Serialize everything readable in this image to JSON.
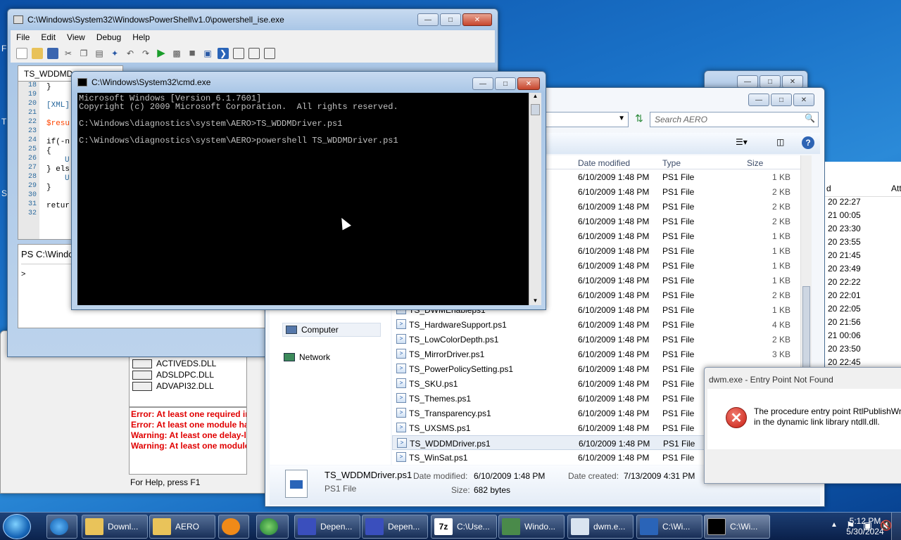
{
  "ise": {
    "title": "C:\\Windows\\System32\\WindowsPowerShell\\v1.0\\powershell_ise.exe",
    "menu": [
      "File",
      "Edit",
      "View",
      "Debug",
      "Help"
    ],
    "tab": "TS_WDDMDriver.ps1",
    "tab_visible": "TS_WDDMD",
    "lines": [
      "18",
      "19",
      "20",
      "21",
      "22",
      "23",
      "24",
      "25",
      "26",
      "27",
      "28",
      "29",
      "30",
      "31",
      "32"
    ],
    "code": [
      "}",
      "[XML]",
      "$resu",
      "if(-n",
      "{",
      "U",
      "} els",
      "U",
      "}",
      "retur"
    ],
    "console_line1": "PS C:\\Windo",
    "console_prompt": ">"
  },
  "cmd": {
    "title": "C:\\Windows\\System32\\cmd.exe",
    "line1": "Microsoft Windows [Version 6.1.7601]",
    "line2": "Copyright (c) 2009 Microsoft Corporation.  All rights reserved.",
    "line3": "C:\\Windows\\diagnostics\\system\\AERO>TS_WDDMDriver.ps1",
    "line4": "C:\\Windows\\diagnostics\\system\\AERO>powershell TS_WDDMDriver.ps1"
  },
  "depwalk": {
    "modules": [
      "ACTIVEDS.DLL",
      "ADSLDPC.DLL",
      "ADVAPI32.DLL"
    ],
    "errors": [
      "Error: At least one required im",
      "Error: At least one module has",
      "Warning: At least one delay-lo",
      "Warning: At least one module"
    ],
    "status": "For Help, press F1"
  },
  "explorer": {
    "search_placeholder": "Search AERO",
    "columns": {
      "date": "Date modified",
      "type": "Type",
      "size": "Size"
    },
    "nav": {
      "computer": "Computer",
      "network": "Network"
    },
    "files": [
      {
        "name": "",
        "date": "6/10/2009 1:48 PM",
        "type": "PS1 File",
        "size": "1 KB"
      },
      {
        "name": "",
        "date": "6/10/2009 1:48 PM",
        "type": "PS1 File",
        "size": "2 KB"
      },
      {
        "name": "",
        "date": "6/10/2009 1:48 PM",
        "type": "PS1 File",
        "size": "2 KB"
      },
      {
        "name": "",
        "date": "6/10/2009 1:48 PM",
        "type": "PS1 File",
        "size": "2 KB"
      },
      {
        "name": "",
        "date": "6/10/2009 1:48 PM",
        "type": "PS1 File",
        "size": "1 KB"
      },
      {
        "name": "",
        "date": "6/10/2009 1:48 PM",
        "type": "PS1 File",
        "size": "1 KB"
      },
      {
        "name": "",
        "date": "6/10/2009 1:48 PM",
        "type": "PS1 File",
        "size": "1 KB"
      },
      {
        "name": "",
        "date": "6/10/2009 1:48 PM",
        "type": "PS1 File",
        "size": "1 KB"
      },
      {
        "name": "",
        "date": "6/10/2009 1:48 PM",
        "type": "PS1 File",
        "size": "2 KB"
      },
      {
        "name": "TS_DWMEnableps1",
        "date": "6/10/2009 1:48 PM",
        "type": "PS1 File",
        "size": "1 KB"
      },
      {
        "name": "TS_HardwareSupport.ps1",
        "date": "6/10/2009 1:48 PM",
        "type": "PS1 File",
        "size": "4 KB"
      },
      {
        "name": "TS_LowColorDepth.ps1",
        "date": "6/10/2009 1:48 PM",
        "type": "PS1 File",
        "size": "2 KB"
      },
      {
        "name": "TS_MirrorDriver.ps1",
        "date": "6/10/2009 1:48 PM",
        "type": "PS1 File",
        "size": "3 KB"
      },
      {
        "name": "TS_PowerPolicySetting.ps1",
        "date": "6/10/2009 1:48 PM",
        "type": "PS1 File",
        "size": ""
      },
      {
        "name": "TS_SKU.ps1",
        "date": "6/10/2009 1:48 PM",
        "type": "PS1 File",
        "size": ""
      },
      {
        "name": "TS_Themes.ps1",
        "date": "6/10/2009 1:48 PM",
        "type": "PS1 File",
        "size": ""
      },
      {
        "name": "TS_Transparency.ps1",
        "date": "6/10/2009 1:48 PM",
        "type": "PS1 File",
        "size": ""
      },
      {
        "name": "TS_UXSMS.ps1",
        "date": "6/10/2009 1:48 PM",
        "type": "PS1 File",
        "size": ""
      },
      {
        "name": "TS_WDDMDriver.ps1",
        "date": "6/10/2009 1:48 PM",
        "type": "PS1 File",
        "size": ""
      },
      {
        "name": "TS_WinSat.ps1",
        "date": "6/10/2009 1:48 PM",
        "type": "PS1 File",
        "size": ""
      }
    ],
    "details": {
      "name": "TS_WDDMDriver.ps1",
      "kind": "PS1 File",
      "mod_label": "Date modified:",
      "mod": "6/10/2009 1:48 PM",
      "size_label": "Size:",
      "size": "682 bytes",
      "created_label": "Date created:",
      "created": "7/13/2009 4:31 PM"
    }
  },
  "datelist": {
    "header_d": "d",
    "header_att": "Att",
    "dates": [
      "20 22:27",
      "21 00:05",
      "20 23:30",
      "20 23:55",
      "20 21:45",
      "20 23:49",
      "20 22:22",
      "20 22:01",
      "20 22:05",
      "20 21:56",
      "21 00:06",
      "20 23:50",
      "20 22:45"
    ]
  },
  "dialog": {
    "title": "dwm.exe - Entry Point Not Found",
    "line1": "The procedure entry point RtlPublishWr",
    "line2": "in the dynamic link library ntdll.dll."
  },
  "taskbar": {
    "items": [
      "Downl...",
      "AERO",
      "",
      "",
      "Depen...",
      "Depen...",
      "C:\\Use...",
      "Windo...",
      "dwm.e...",
      "C:\\Wi...",
      "C:\\Wi..."
    ],
    "time": "5:12 PM",
    "date": "5/30/2024"
  },
  "desktop_chars": [
    "F",
    "T",
    "S"
  ]
}
